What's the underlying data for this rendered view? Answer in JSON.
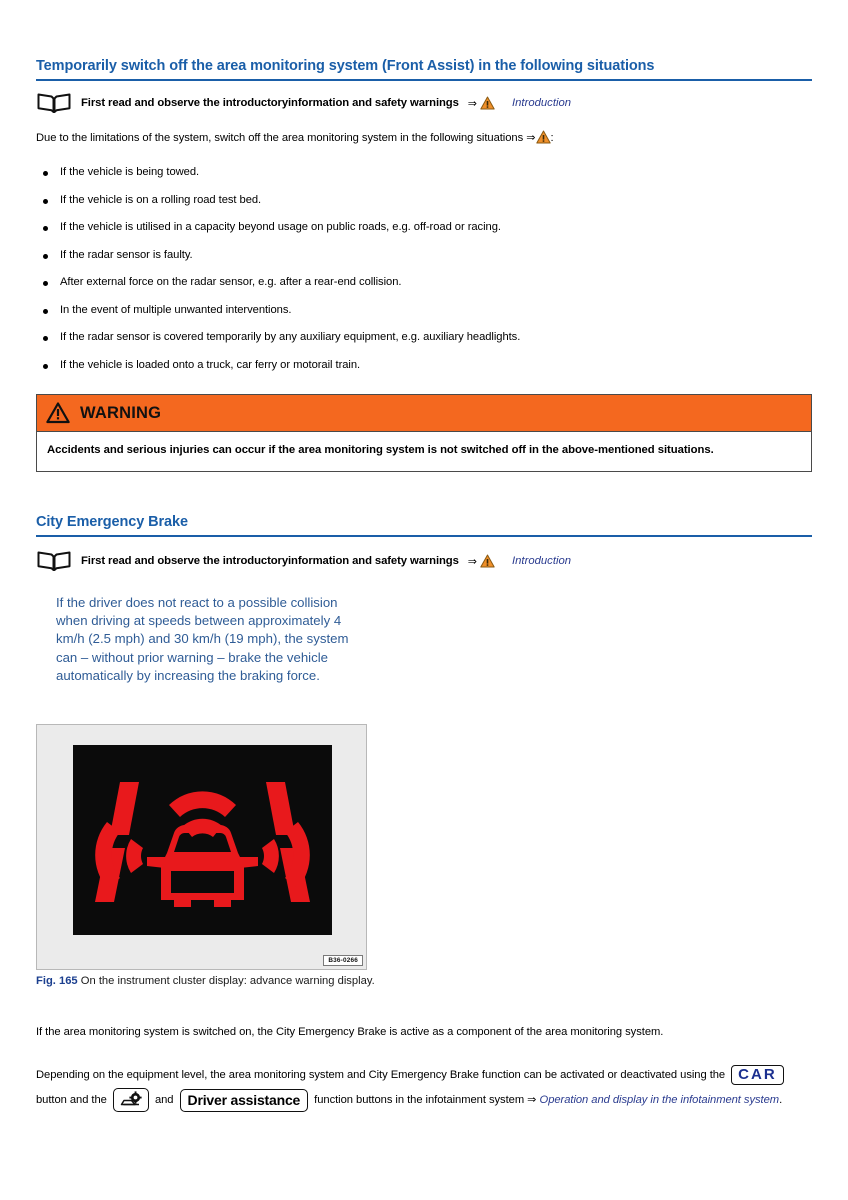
{
  "document": {
    "page_background": "#ffffff",
    "heading_color": "#1a5ea8",
    "warning_bar_color": "#f4681f",
    "xref_color": "#2a3b8f",
    "note_color": "#2f5c96"
  },
  "section1": {
    "heading": "Temporarily switch off the area monitoring system (Front Assist) in the following situations",
    "read_first": {
      "icon": "open-book-icon",
      "text": "First read and observe the introductoryinformation and safety warnings",
      "arrow": "⇒",
      "warning_icon": "warning-triangle-icon",
      "link": "Introduction"
    },
    "intro_before": "Due to the limitations of the system, switch off the area monitoring system in the following situations ",
    "intro_arrow": "⇒",
    "intro_after": ":",
    "bullets": [
      "If the vehicle is being towed.",
      "If the vehicle is on a rolling road test bed.",
      "If the vehicle is utilised in a capacity beyond usage on public roads, e.g. off-road or racing.",
      "If the radar sensor is faulty.",
      "After external force on the radar sensor, e.g. after a rear-end collision.",
      "In the event of multiple unwanted interventions.",
      "If the radar sensor is covered temporarily by any auxiliary equipment, e.g. auxiliary headlights.",
      "If the vehicle is loaded onto a truck, car ferry or motorail train."
    ],
    "warning_box": {
      "icon": "warning-triangle-icon",
      "title": "WARNING",
      "body": "Accidents and serious injuries can occur if the area monitoring system is not switched off in the above-mentioned situations."
    }
  },
  "section2": {
    "heading": "City Emergency Brake",
    "read_first": {
      "icon": "open-book-icon",
      "text": "First read and observe the introductoryinformation and safety warnings",
      "arrow": "⇒",
      "warning_icon": "warning-triangle-icon",
      "link": "Introduction"
    },
    "note": "If the driver does not react to a possible collision when driving at speeds between approximately 4 km/h (2.5 mph) and 30 km/h (19 mph), the system can – without prior warning – brake the vehicle automatically by increasing the braking force.",
    "figure": {
      "image_alt": "front-assist-advance-warning-telltale",
      "image_code": "B36-0266",
      "caption_label": "Fig. 165",
      "caption_text": "On the instrument cluster display: advance warning display."
    },
    "paragraph_1": "If the area monitoring system is switched on, the City Emergency Brake is active as a component of the area monitoring system.",
    "paragraph_2": {
      "part1": "Depending on the equipment level, the area monitoring system and City Emergency Brake function can be activated or deactivated using the ",
      "car_button": "CAR",
      "part2": " button and the ",
      "gear_button_icon": "car-settings-icon",
      "part3": " and ",
      "driver_assistance_button": "Driver assistance",
      "part4": " function buttons in the infotainment system ",
      "arrow": "⇒",
      "link": "Operation and display in the infotainment system",
      "end": "."
    }
  }
}
